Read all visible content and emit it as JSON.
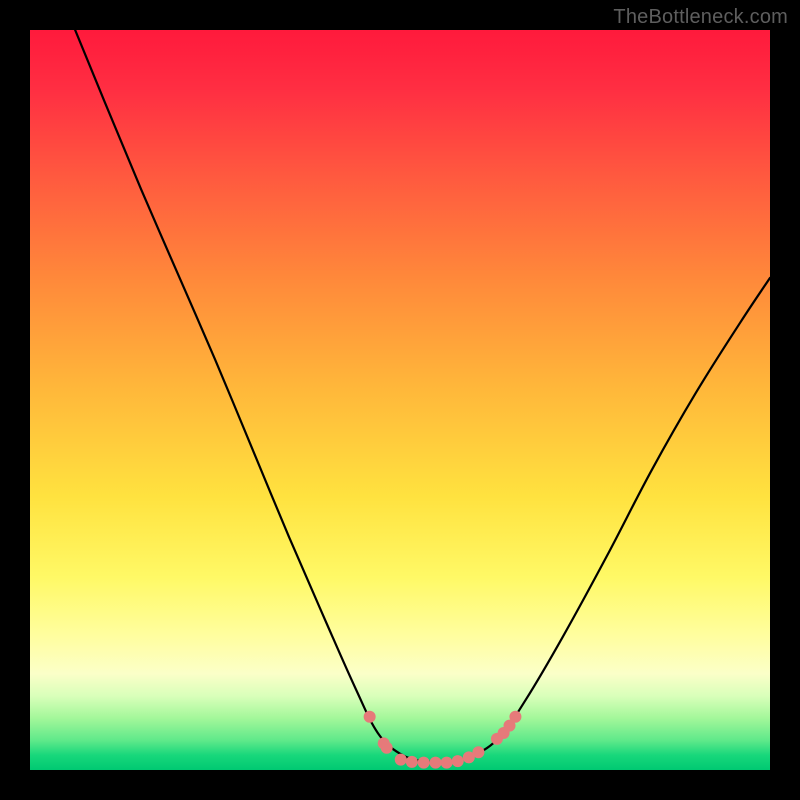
{
  "attribution": "TheBottleneck.com",
  "colors": {
    "curve_stroke": "#000000",
    "marker_fill": "#e67a7a",
    "background_black": "#000000"
  },
  "chart_data": {
    "type": "line",
    "title": "",
    "xlabel": "",
    "ylabel": "",
    "xlim": [
      0,
      1
    ],
    "ylim": [
      0,
      1
    ],
    "curve": [
      {
        "x": 0.061,
        "y": 1.0
      },
      {
        "x": 0.1,
        "y": 0.905
      },
      {
        "x": 0.15,
        "y": 0.785
      },
      {
        "x": 0.2,
        "y": 0.67
      },
      {
        "x": 0.25,
        "y": 0.555
      },
      {
        "x": 0.3,
        "y": 0.435
      },
      {
        "x": 0.35,
        "y": 0.315
      },
      {
        "x": 0.4,
        "y": 0.2
      },
      {
        "x": 0.44,
        "y": 0.11
      },
      {
        "x": 0.47,
        "y": 0.05
      },
      {
        "x": 0.5,
        "y": 0.022
      },
      {
        "x": 0.53,
        "y": 0.012
      },
      {
        "x": 0.565,
        "y": 0.012
      },
      {
        "x": 0.6,
        "y": 0.02
      },
      {
        "x": 0.635,
        "y": 0.045
      },
      {
        "x": 0.67,
        "y": 0.095
      },
      {
        "x": 0.72,
        "y": 0.18
      },
      {
        "x": 0.78,
        "y": 0.29
      },
      {
        "x": 0.84,
        "y": 0.405
      },
      {
        "x": 0.9,
        "y": 0.51
      },
      {
        "x": 0.96,
        "y": 0.605
      },
      {
        "x": 1.0,
        "y": 0.665
      }
    ],
    "markers": [
      {
        "x": 0.459,
        "y": 0.072
      },
      {
        "x": 0.478,
        "y": 0.036
      },
      {
        "x": 0.482,
        "y": 0.03
      },
      {
        "x": 0.501,
        "y": 0.014
      },
      {
        "x": 0.516,
        "y": 0.011
      },
      {
        "x": 0.532,
        "y": 0.01
      },
      {
        "x": 0.548,
        "y": 0.01
      },
      {
        "x": 0.563,
        "y": 0.01
      },
      {
        "x": 0.578,
        "y": 0.012
      },
      {
        "x": 0.593,
        "y": 0.017
      },
      {
        "x": 0.606,
        "y": 0.024
      },
      {
        "x": 0.631,
        "y": 0.042
      },
      {
        "x": 0.64,
        "y": 0.05
      },
      {
        "x": 0.648,
        "y": 0.06
      },
      {
        "x": 0.656,
        "y": 0.072
      }
    ],
    "marker_radius_px": 6
  }
}
